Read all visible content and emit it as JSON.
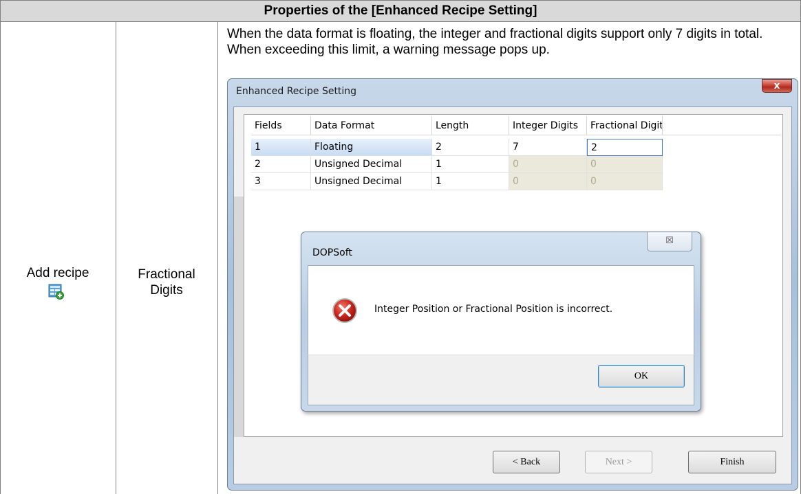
{
  "document": {
    "header": "Properties of the [Enhanced Recipe Setting]",
    "column1_label": "Add recipe",
    "column2_label_line1": "Fractional",
    "column2_label_line2": "Digits",
    "description": "When the data format is floating, the integer and fractional digits support only 7 digits in total. When exceeding this limit, a warning message pops up.",
    "icons": [
      "add-recipe-icon"
    ]
  },
  "window": {
    "title": "Enhanced Recipe Setting",
    "close_glyph": "x",
    "grid": {
      "headers": [
        "Fields",
        "Data Format",
        "Length",
        "Integer Digits",
        "Fractional Digits"
      ],
      "rows": [
        {
          "field": "1",
          "format": "Floating",
          "length": "2",
          "integer": "7",
          "fractional": "2",
          "selected": true
        },
        {
          "field": "2",
          "format": "Unsigned Decimal",
          "length": "1",
          "integer": "0",
          "fractional": "0",
          "selected": false
        },
        {
          "field": "3",
          "format": "Unsigned Decimal",
          "length": "1",
          "integer": "0",
          "fractional": "0",
          "selected": false
        }
      ]
    },
    "buttons": {
      "back": "< Back",
      "next": "Next >",
      "finish": "Finish"
    }
  },
  "message_box": {
    "title": "DOPSoft",
    "close_glyph": "☒",
    "text": "Integer Position or Fractional Position is incorrect.",
    "ok": "OK",
    "icon": "error-icon"
  },
  "colors": {
    "header_bg": "#d9d9d9",
    "error_red": "#c0272d",
    "selection_blue": "#c9dcf3"
  }
}
